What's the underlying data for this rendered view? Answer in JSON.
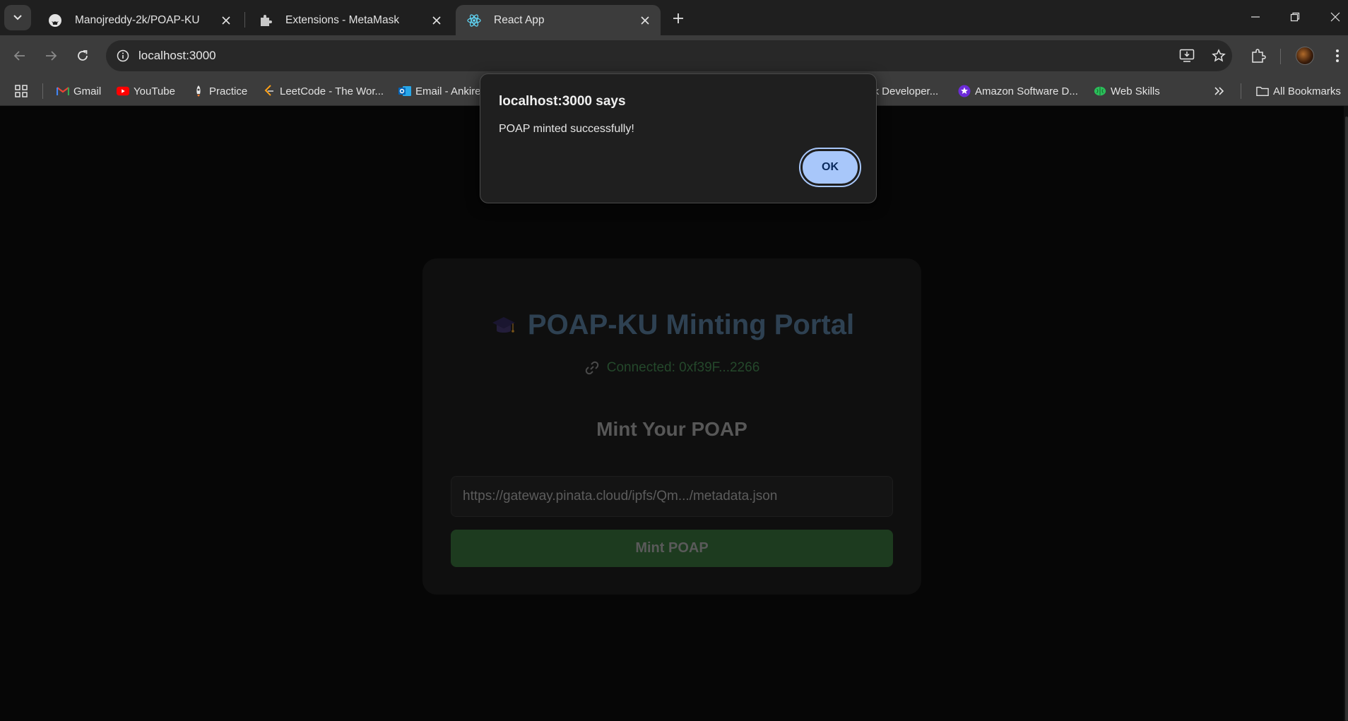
{
  "browser": {
    "tabs": [
      {
        "title": "Manojreddy-2k/POAP-KU",
        "favicon": "github-icon",
        "active": false
      },
      {
        "title": "Extensions - MetaMask",
        "favicon": "puzzle-icon",
        "active": false
      },
      {
        "title": "React App",
        "favicon": "react-icon",
        "active": true
      }
    ],
    "url": "localhost:3000",
    "bookmarks": [
      {
        "label": "Gmail",
        "icon": "gmail-icon"
      },
      {
        "label": "YouTube",
        "icon": "youtube-icon"
      },
      {
        "label": "Practice",
        "icon": "rocket-icon"
      },
      {
        "label": "LeetCode - The Wor...",
        "icon": "leetcode-icon"
      },
      {
        "label": "Email - Ankire",
        "icon": "outlook-icon"
      },
      {
        "label": "ck Developer...",
        "icon": "generic-icon"
      },
      {
        "label": "Amazon Software D...",
        "icon": "star-badge-icon"
      },
      {
        "label": "Web Skills",
        "icon": "brain-icon"
      }
    ],
    "all_bookmarks_label": "All Bookmarks"
  },
  "page": {
    "title": "POAP-KU Minting Portal",
    "connected": "Connected: 0xf39F...2266",
    "mint_heading": "Mint Your POAP",
    "metadata_input": {
      "value": "",
      "placeholder": "https://gateway.pinata.cloud/ipfs/Qm.../metadata.json"
    },
    "mint_button": "Mint POAP"
  },
  "alert": {
    "title": "localhost:3000 says",
    "message": "POAP minted successfully!",
    "ok_label": "OK"
  },
  "colors": {
    "title": "#2e4152",
    "connected": "#24482b",
    "mint_button_bg": "#1d3b1f",
    "alert_ok_bg": "#a8c7fa"
  }
}
